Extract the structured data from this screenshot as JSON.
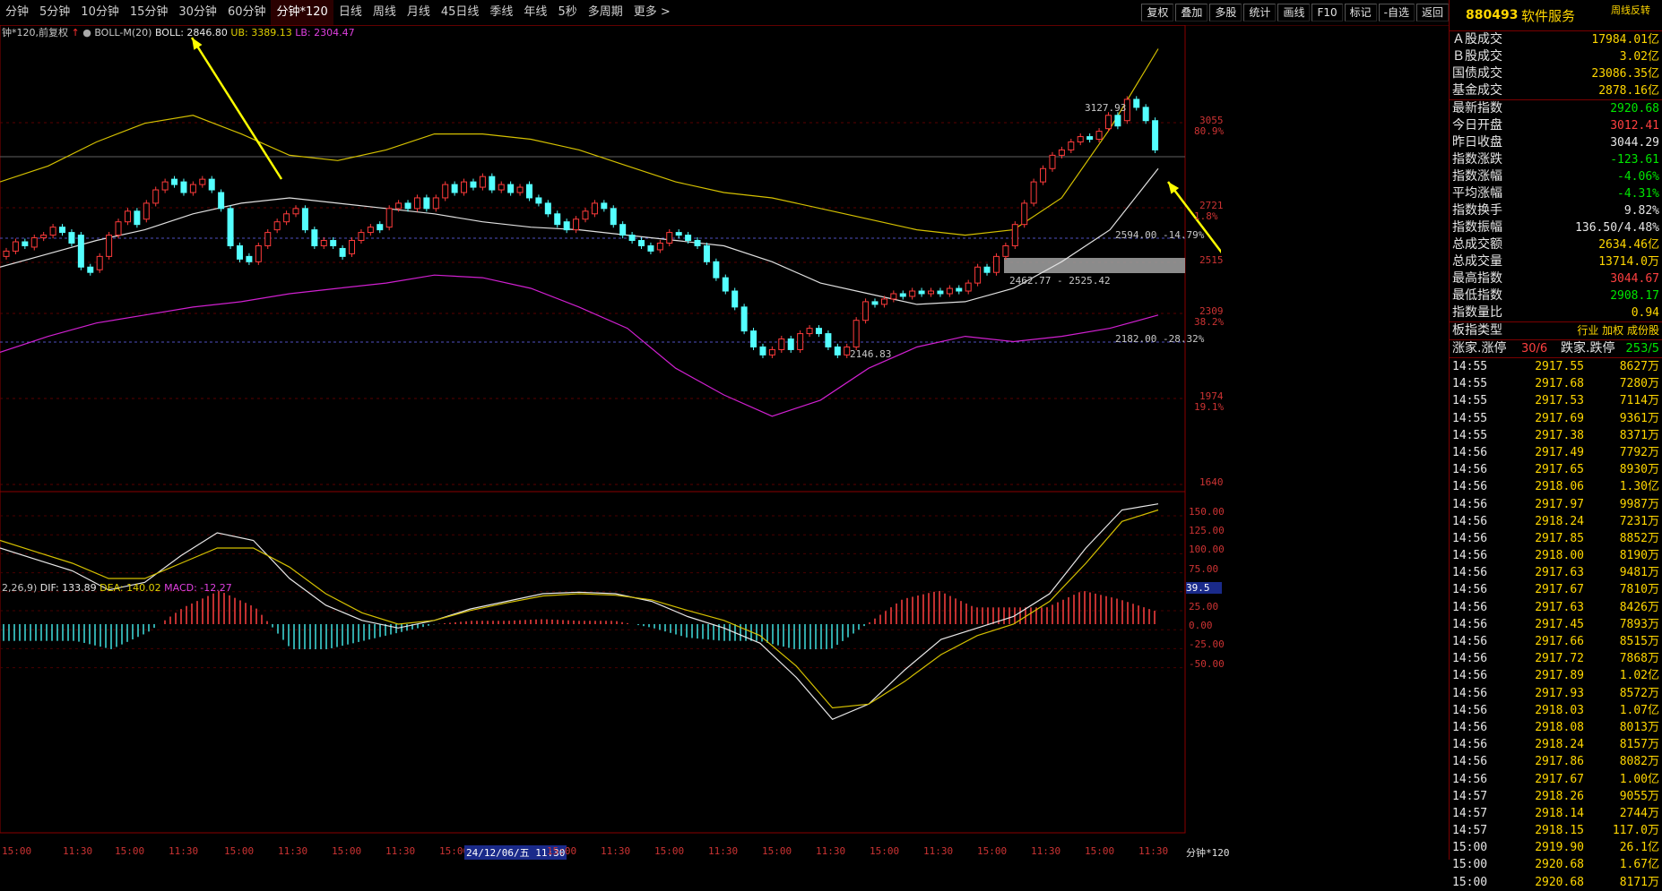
{
  "tabs": [
    {
      "label": "分钟"
    },
    {
      "label": "5分钟"
    },
    {
      "label": "10分钟"
    },
    {
      "label": "15分钟"
    },
    {
      "label": "30分钟"
    },
    {
      "label": "60分钟"
    },
    {
      "label": "分钟*120",
      "active": true
    },
    {
      "label": "日线"
    },
    {
      "label": "周线"
    },
    {
      "label": "月线"
    },
    {
      "label": "45日线"
    },
    {
      "label": "季线"
    },
    {
      "label": "年线"
    },
    {
      "label": "5秒"
    },
    {
      "label": "多周期"
    },
    {
      "label": "更多 >"
    }
  ],
  "tools": [
    "复权",
    "叠加",
    "多股",
    "统计",
    "画线",
    "F10",
    "标记",
    "-自选",
    "返回"
  ],
  "main_legend": {
    "period": "钟*120,前复权",
    "indicator": "BOLL-M(20)",
    "boll": "BOLL: 2846.80",
    "ub": "UB: 3389.13",
    "lb": "LB: 2304.47"
  },
  "macd_legend": {
    "params": "2,26,9)",
    "dif": "DIF: 133.89",
    "dea": "DEA: 140.02",
    "macd": "MACD: -12.27"
  },
  "price_axis": [
    {
      "price": "3055",
      "pct": "80.9%"
    },
    {
      "price": "2721",
      "pct": "1.8%"
    },
    {
      "price": "2515",
      "pct": ""
    },
    {
      "price": "2309",
      "pct": "38.2%"
    },
    {
      "price": "1974",
      "pct": "19.1%"
    },
    {
      "price": "1640",
      "pct": ""
    }
  ],
  "macd_axis": [
    "150.00",
    "125.00",
    "100.00",
    "75.00",
    "50.00",
    "25.00",
    "0.00",
    "-25.00",
    "-50.00"
  ],
  "macd_marker": "39.5",
  "annotations": {
    "high": "3127.93",
    "low": "2146.83",
    "level1": "2594.00 -14.79%",
    "level2": "2182.00 -28.32%",
    "zone": "2462.77 - 2525.42"
  },
  "x_axis": [
    "15:00",
    "11:30",
    "15:00",
    "11:30",
    "15:00",
    "11:30",
    "15:00",
    "11:30",
    "15:00",
    "24/12/06/五 11:30",
    "15:00",
    "11:30",
    "15:00",
    "11:30",
    "15:00",
    "11:30",
    "15:00",
    "11:30",
    "15:00",
    "11:30",
    "15:00",
    "11:30"
  ],
  "x_axis_end": "分钟*120",
  "sidebar": {
    "code": "880493",
    "name": "软件服务",
    "tag": "周线反转",
    "stats": [
      {
        "label": "Ａ股成交",
        "value": "17984.01亿",
        "color": "#ffd700"
      },
      {
        "label": "Ｂ股成交",
        "value": "3.02亿",
        "color": "#ffd700"
      },
      {
        "label": "国债成交",
        "value": "23086.35亿",
        "color": "#ffd700"
      },
      {
        "label": "基金成交",
        "value": "2878.16亿",
        "color": "#ffd700"
      }
    ],
    "index": [
      {
        "label": "最新指数",
        "value": "2920.68",
        "color": "#00e600"
      },
      {
        "label": "今日开盘",
        "value": "3012.41",
        "color": "#ff4040"
      },
      {
        "label": "昨日收盘",
        "value": "3044.29",
        "color": "#e6e6e6"
      },
      {
        "label": "指数涨跌",
        "value": "-123.61",
        "color": "#00e600"
      },
      {
        "label": "指数涨幅",
        "value": "-4.06%",
        "color": "#00e600"
      },
      {
        "label": "平均涨幅",
        "value": "-4.31%",
        "color": "#00e600"
      },
      {
        "label": "指数换手",
        "value": "9.82%",
        "color": "#e6e6e6"
      },
      {
        "label": "指数振幅",
        "value": "136.50/4.48%",
        "color": "#e6e6e6"
      },
      {
        "label": "总成交额",
        "value": "2634.46亿",
        "color": "#ffd700"
      },
      {
        "label": "总成交量",
        "value": "13714.0万",
        "color": "#ffd700"
      },
      {
        "label": "最高指数",
        "value": "3044.67",
        "color": "#ff4040"
      },
      {
        "label": "最低指数",
        "value": "2908.17",
        "color": "#00e600"
      },
      {
        "label": "指数量比",
        "value": "0.94",
        "color": "#ffd700"
      }
    ],
    "type_label": "板指类型",
    "type_values": "行业 加权 成份股",
    "updown_label": "涨家.涨停",
    "updown_value": "30/6",
    "down_label": "跌家.跌停",
    "down_value": "253/5",
    "ticks": [
      {
        "time": "14:55",
        "price": "2917.55",
        "vol": "8627万"
      },
      {
        "time": "14:55",
        "price": "2917.68",
        "vol": "7280万"
      },
      {
        "time": "14:55",
        "price": "2917.53",
        "vol": "7114万"
      },
      {
        "time": "14:55",
        "price": "2917.69",
        "vol": "9361万"
      },
      {
        "time": "14:55",
        "price": "2917.38",
        "vol": "8371万"
      },
      {
        "time": "14:56",
        "price": "2917.49",
        "vol": "7792万"
      },
      {
        "time": "14:56",
        "price": "2917.65",
        "vol": "8930万"
      },
      {
        "time": "14:56",
        "price": "2918.06",
        "vol": "1.30亿"
      },
      {
        "time": "14:56",
        "price": "2917.97",
        "vol": "9987万"
      },
      {
        "time": "14:56",
        "price": "2918.24",
        "vol": "7231万"
      },
      {
        "time": "14:56",
        "price": "2917.85",
        "vol": "8852万"
      },
      {
        "time": "14:56",
        "price": "2918.00",
        "vol": "8190万"
      },
      {
        "time": "14:56",
        "price": "2917.63",
        "vol": "9481万"
      },
      {
        "time": "14:56",
        "price": "2917.67",
        "vol": "7810万"
      },
      {
        "time": "14:56",
        "price": "2917.63",
        "vol": "8426万"
      },
      {
        "time": "14:56",
        "price": "2917.45",
        "vol": "7893万"
      },
      {
        "time": "14:56",
        "price": "2917.66",
        "vol": "8515万"
      },
      {
        "time": "14:56",
        "price": "2917.72",
        "vol": "7868万"
      },
      {
        "time": "14:56",
        "price": "2917.89",
        "vol": "1.02亿"
      },
      {
        "time": "14:56",
        "price": "2917.93",
        "vol": "8572万"
      },
      {
        "time": "14:56",
        "price": "2918.03",
        "vol": "1.07亿"
      },
      {
        "time": "14:56",
        "price": "2918.08",
        "vol": "8013万"
      },
      {
        "time": "14:56",
        "price": "2918.24",
        "vol": "8157万"
      },
      {
        "time": "14:56",
        "price": "2917.86",
        "vol": "8082万"
      },
      {
        "time": "14:56",
        "price": "2917.67",
        "vol": "1.00亿"
      },
      {
        "time": "14:57",
        "price": "2918.26",
        "vol": "9055万"
      },
      {
        "time": "14:57",
        "price": "2918.14",
        "vol": "2744万"
      },
      {
        "time": "14:57",
        "price": "2918.15",
        "vol": "117.0万"
      },
      {
        "time": "15:00",
        "price": "2919.90",
        "vol": "26.1亿"
      },
      {
        "time": "15:00",
        "price": "2920.68",
        "vol": "1.67亿"
      },
      {
        "time": "15:00",
        "price": "2920.68",
        "vol": "8171万"
      }
    ]
  },
  "chart_data": {
    "type": "candlestick",
    "price_range": [
      1640,
      3389
    ],
    "candles": [
      [
        2520,
        2540
      ],
      [
        2540,
        2575
      ],
      [
        2575,
        2560
      ],
      [
        2555,
        2590
      ],
      [
        2590,
        2600
      ],
      [
        2600,
        2630
      ],
      [
        2630,
        2610
      ],
      [
        2610,
        2570
      ],
      [
        2600,
        2480
      ],
      [
        2480,
        2460
      ],
      [
        2470,
        2520
      ],
      [
        2520,
        2600
      ],
      [
        2600,
        2650
      ],
      [
        2650,
        2690
      ],
      [
        2690,
        2640
      ],
      [
        2660,
        2720
      ],
      [
        2720,
        2770
      ],
      [
        2770,
        2800
      ],
      [
        2810,
        2790
      ],
      [
        2800,
        2760
      ],
      [
        2760,
        2790
      ],
      [
        2790,
        2810
      ],
      [
        2810,
        2770
      ],
      [
        2760,
        2700
      ],
      [
        2700,
        2560
      ],
      [
        2560,
        2510
      ],
      [
        2520,
        2500
      ],
      [
        2500,
        2560
      ],
      [
        2560,
        2610
      ],
      [
        2620,
        2650
      ],
      [
        2650,
        2680
      ],
      [
        2680,
        2700
      ],
      [
        2700,
        2620
      ],
      [
        2620,
        2560
      ],
      [
        2560,
        2580
      ],
      [
        2580,
        2560
      ],
      [
        2550,
        2520
      ],
      [
        2530,
        2580
      ],
      [
        2580,
        2610
      ],
      [
        2610,
        2630
      ],
      [
        2640,
        2620
      ],
      [
        2630,
        2700
      ],
      [
        2700,
        2720
      ],
      [
        2720,
        2700
      ],
      [
        2700,
        2740
      ],
      [
        2740,
        2700
      ],
      [
        2700,
        2740
      ],
      [
        2740,
        2790
      ],
      [
        2790,
        2760
      ],
      [
        2760,
        2800
      ],
      [
        2800,
        2780
      ],
      [
        2780,
        2820
      ],
      [
        2820,
        2770
      ],
      [
        2770,
        2790
      ],
      [
        2790,
        2760
      ],
      [
        2760,
        2780
      ],
      [
        2790,
        2740
      ],
      [
        2740,
        2720
      ],
      [
        2720,
        2680
      ],
      [
        2680,
        2640
      ],
      [
        2650,
        2620
      ],
      [
        2620,
        2660
      ],
      [
        2660,
        2690
      ],
      [
        2680,
        2720
      ],
      [
        2720,
        2700
      ],
      [
        2700,
        2640
      ],
      [
        2640,
        2600
      ],
      [
        2600,
        2580
      ],
      [
        2580,
        2560
      ],
      [
        2560,
        2540
      ],
      [
        2545,
        2570
      ],
      [
        2570,
        2610
      ],
      [
        2610,
        2600
      ],
      [
        2600,
        2580
      ],
      [
        2580,
        2560
      ],
      [
        2560,
        2500
      ],
      [
        2500,
        2440
      ],
      [
        2440,
        2390
      ],
      [
        2390,
        2330
      ],
      [
        2330,
        2240
      ],
      [
        2240,
        2180
      ],
      [
        2180,
        2150
      ],
      [
        2150,
        2170
      ],
      [
        2170,
        2210
      ],
      [
        2210,
        2170
      ],
      [
        2170,
        2230
      ],
      [
        2230,
        2250
      ],
      [
        2250,
        2230
      ],
      [
        2230,
        2180
      ],
      [
        2180,
        2150
      ],
      [
        2150,
        2180
      ],
      [
        2180,
        2280
      ],
      [
        2280,
        2350
      ],
      [
        2350,
        2340
      ],
      [
        2340,
        2360
      ],
      [
        2360,
        2380
      ],
      [
        2380,
        2370
      ],
      [
        2370,
        2390
      ],
      [
        2390,
        2380
      ],
      [
        2380,
        2390
      ],
      [
        2390,
        2380
      ],
      [
        2380,
        2400
      ],
      [
        2400,
        2390
      ],
      [
        2390,
        2420
      ],
      [
        2420,
        2480
      ],
      [
        2480,
        2460
      ],
      [
        2460,
        2520
      ],
      [
        2520,
        2560
      ],
      [
        2560,
        2640
      ],
      [
        2640,
        2720
      ],
      [
        2720,
        2800
      ],
      [
        2800,
        2850
      ],
      [
        2850,
        2900
      ],
      [
        2900,
        2920
      ],
      [
        2920,
        2950
      ],
      [
        2950,
        2970
      ],
      [
        2970,
        2960
      ],
      [
        2960,
        2990
      ],
      [
        3000,
        3050
      ],
      [
        3050,
        3010
      ],
      [
        3030,
        3110
      ],
      [
        3110,
        3080
      ],
      [
        3080,
        3030
      ],
      [
        3030,
        2920
      ]
    ],
    "boll_mid": [
      2480,
      2530,
      2580,
      2620,
      2680,
      2720,
      2740,
      2720,
      2700,
      2680,
      2650,
      2630,
      2620,
      2600,
      2580,
      2560,
      2500,
      2420,
      2380,
      2340,
      2350,
      2400,
      2500,
      2620,
      2850
    ],
    "boll_upper": [
      2800,
      2860,
      2950,
      3020,
      3050,
      2980,
      2900,
      2880,
      2920,
      2980,
      2980,
      2960,
      2920,
      2860,
      2800,
      2760,
      2740,
      2700,
      2660,
      2620,
      2600,
      2620,
      2740,
      3000,
      3300
    ],
    "boll_lower": [
      2160,
      2220,
      2270,
      2300,
      2330,
      2350,
      2380,
      2400,
      2420,
      2450,
      2440,
      2400,
      2330,
      2250,
      2100,
      2000,
      1920,
      1980,
      2100,
      2180,
      2220,
      2200,
      2220,
      2250,
      2300
    ],
    "macd_dif": [
      100,
      85,
      70,
      45,
      55,
      90,
      120,
      110,
      60,
      25,
      5,
      -5,
      5,
      20,
      30,
      40,
      42,
      40,
      30,
      10,
      -5,
      -25,
      -70,
      -125,
      -105,
      -60,
      -20,
      -5,
      10,
      40,
      100,
      150,
      158
    ],
    "macd_dea": [
      110,
      95,
      80,
      60,
      60,
      80,
      100,
      100,
      75,
      40,
      15,
      0,
      5,
      18,
      28,
      37,
      40,
      38,
      32,
      18,
      5,
      -15,
      -55,
      -110,
      -105,
      -75,
      -40,
      -15,
      0,
      30,
      80,
      135,
      150
    ]
  }
}
